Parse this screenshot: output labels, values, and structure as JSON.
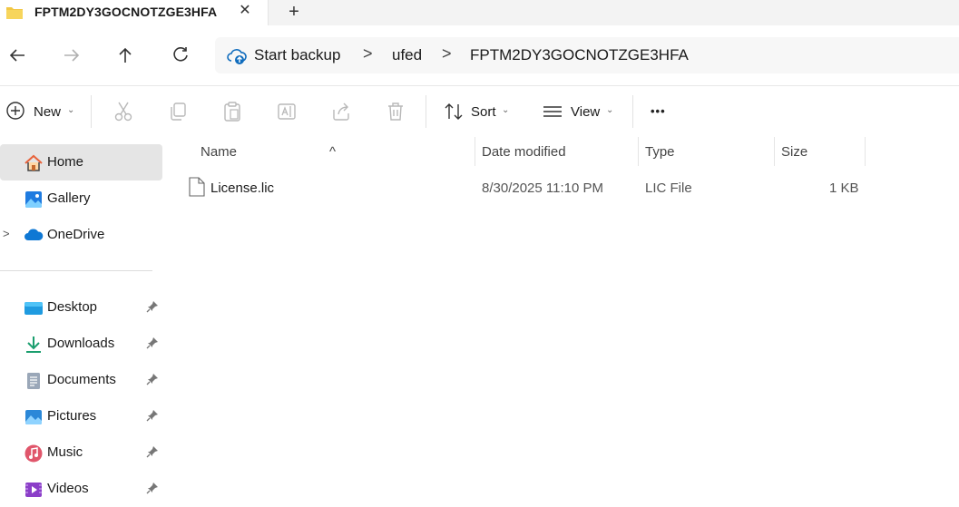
{
  "tab": {
    "title": "FPTM2DY3GOCNOTZGE3HFA",
    "close_glyph": "✕",
    "add_glyph": "+"
  },
  "nav": {
    "back_icon": "arrow-left-icon",
    "forward_icon": "arrow-right-icon",
    "up_icon": "arrow-up-icon",
    "refresh_icon": "refresh-icon"
  },
  "address": {
    "icon": "cloud-backup-icon",
    "crumbs": [
      "Start backup",
      "ufed",
      "FPTM2DY3GOCNOTZGE3HFA"
    ],
    "separator": ">"
  },
  "commands": {
    "new_label": "New",
    "sort_label": "Sort",
    "view_label": "View",
    "more_glyph": "•••",
    "icons": [
      "cut-icon",
      "copy-icon",
      "paste-icon",
      "rename-icon",
      "share-icon",
      "delete-icon"
    ]
  },
  "sidebar": {
    "items": [
      {
        "label": "Home",
        "icon": "home-icon",
        "selected": true
      },
      {
        "label": "Gallery",
        "icon": "gallery-icon"
      },
      {
        "label": "OneDrive",
        "icon": "onedrive-cloud-icon",
        "expandable": true
      },
      {
        "label": "Desktop",
        "icon": "desktop-icon",
        "pinned": true
      },
      {
        "label": "Downloads",
        "icon": "download-icon",
        "pinned": true
      },
      {
        "label": "Documents",
        "icon": "documents-icon",
        "pinned": true
      },
      {
        "label": "Pictures",
        "icon": "pictures-icon",
        "pinned": true
      },
      {
        "label": "Music",
        "icon": "music-icon",
        "pinned": true
      },
      {
        "label": "Videos",
        "icon": "videos-icon",
        "pinned": true
      }
    ],
    "chevron_glyph": ">"
  },
  "table": {
    "columns": [
      "Name",
      "Date modified",
      "Type",
      "Size"
    ],
    "sort_glyph": "^",
    "rows": [
      {
        "name": "License.lic",
        "date": "8/30/2025 11:10 PM",
        "type": "LIC File",
        "size": "1 KB",
        "icon": "file-icon"
      }
    ]
  },
  "colors": {
    "folder_yellow": "#f2c744",
    "accent_blue": "#0067c0",
    "selected_bg": "#e5e5e5"
  }
}
